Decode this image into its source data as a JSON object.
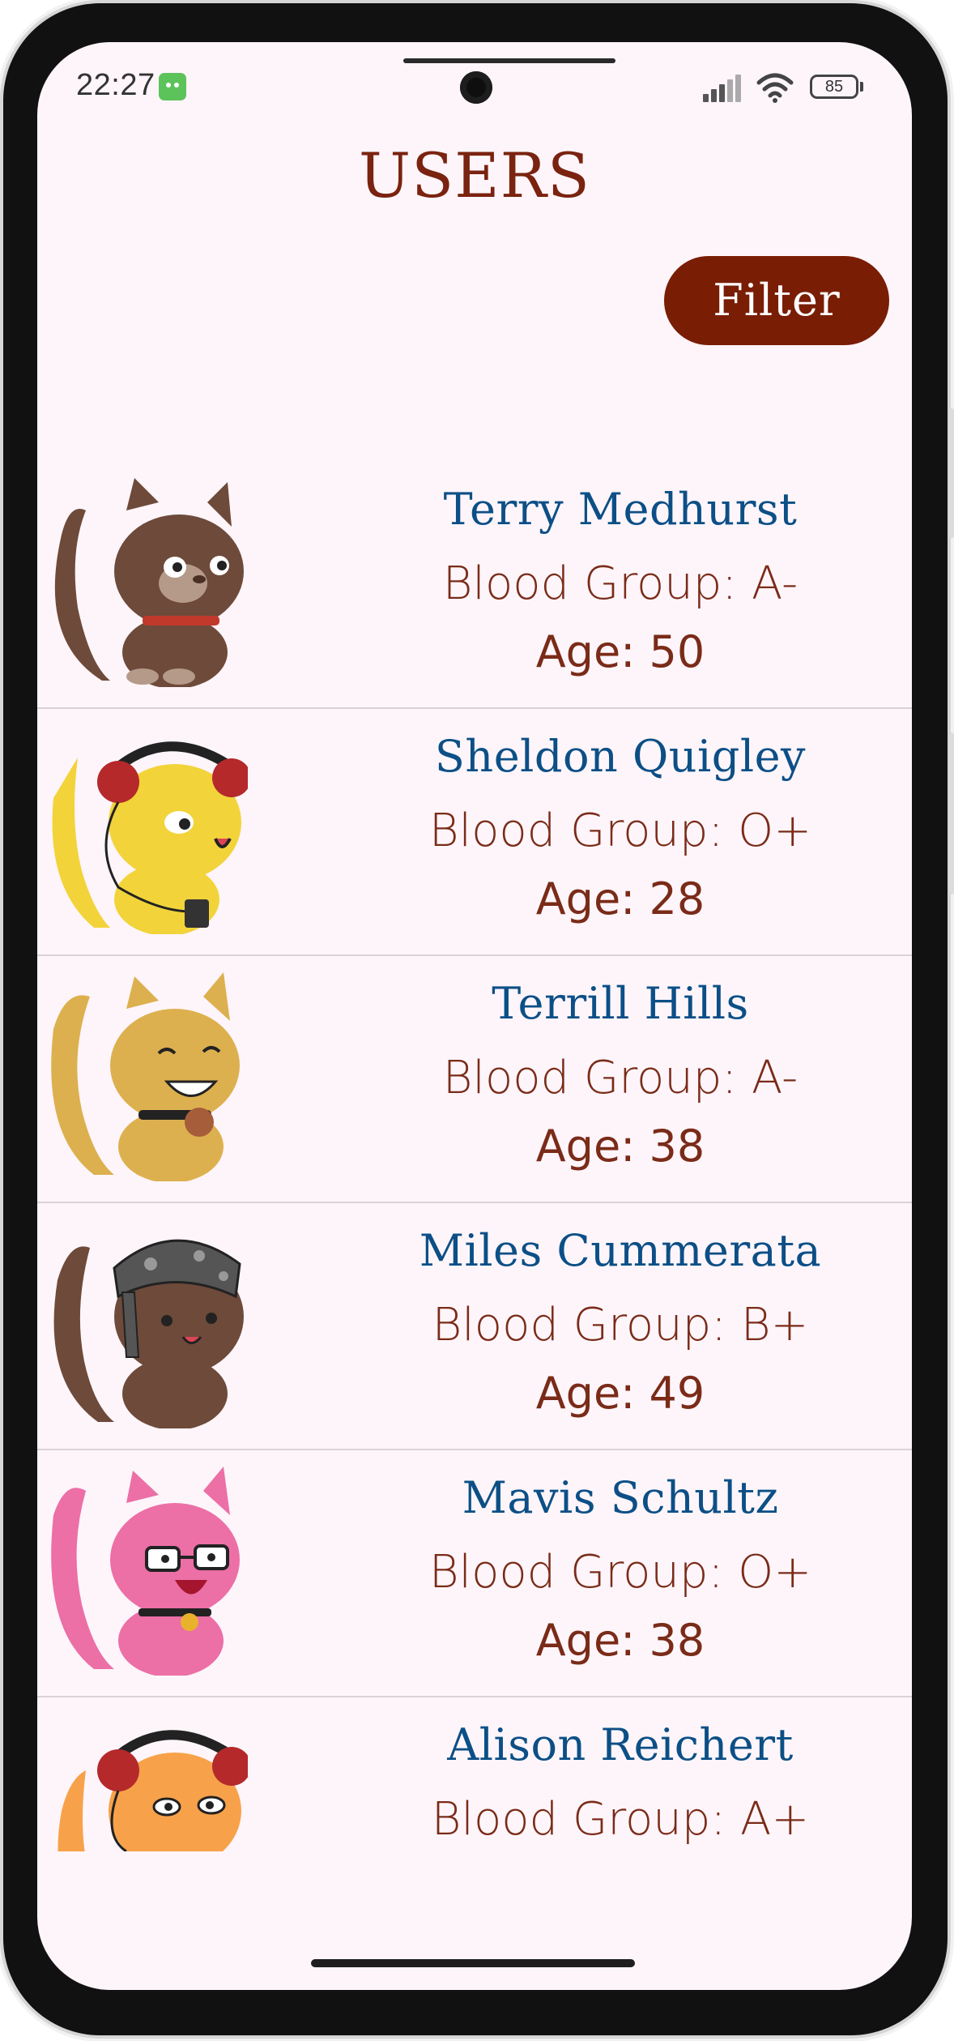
{
  "status_bar": {
    "time": "22:27",
    "battery": "85",
    "app_icon": "android-robot-icon",
    "signal_icon": "cellular-signal-icon",
    "wifi_icon": "wifi-icon"
  },
  "header": {
    "title": "USERS",
    "filter_label": "Filter"
  },
  "users": [
    {
      "name": "Terry Medhurst",
      "blood_group": "Blood Group: A-",
      "age": "Age: 50",
      "avatar": "brown-cat-avatar"
    },
    {
      "name": "Sheldon Quigley",
      "blood_group": "Blood Group: O+",
      "age": "Age: 28",
      "avatar": "yellow-cat-headphones-avatar"
    },
    {
      "name": "Terrill Hills",
      "blood_group": "Blood Group: A-",
      "age": "Age: 38",
      "avatar": "golden-cat-avatar"
    },
    {
      "name": "Miles Cummerata",
      "blood_group": "Blood Group: B+",
      "age": "Age: 49",
      "avatar": "brown-cat-bandana-avatar"
    },
    {
      "name": "Mavis Schultz",
      "blood_group": "Blood Group: O+",
      "age": "Age: 38",
      "avatar": "pink-cat-glasses-avatar"
    },
    {
      "name": "Alison Reichert",
      "blood_group": "Blood Group: A+",
      "age": "",
      "avatar": "orange-cat-headphones-avatar"
    }
  ],
  "colors": {
    "background": "#fdf5fa",
    "title": "#7a2310",
    "filter_button": "#7a1d05",
    "name": "#0c4f86",
    "detail": "#7a2b18"
  }
}
